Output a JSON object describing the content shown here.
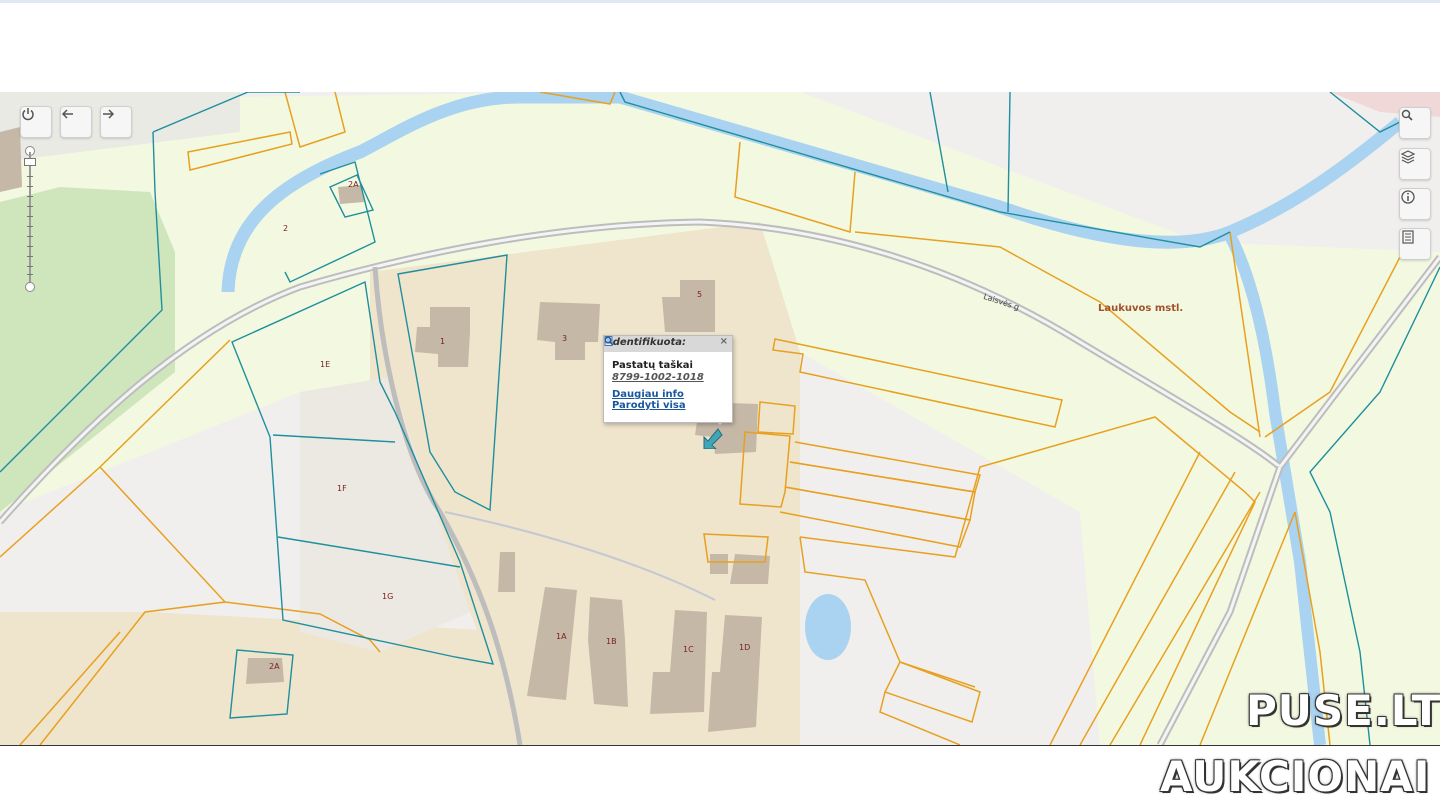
{
  "map": {
    "town_label": "Laukuvos mstl.",
    "street_label": "Laisvės g",
    "parcel_labels": [
      "2A",
      "2",
      "1E",
      "1F",
      "1G",
      "2A"
    ],
    "building_labels": [
      "5",
      "3",
      "1",
      "1A",
      "1B",
      "1C",
      "1D"
    ]
  },
  "controls": {
    "power_icon": "power-icon",
    "back_icon": "arrow-left-icon",
    "forward_icon": "arrow-right-icon",
    "search_icon": "search-icon",
    "layers_icon": "layers-icon",
    "info_icon": "info-icon",
    "legend_icon": "document-icon"
  },
  "popup": {
    "header": "Identifikuota:",
    "title": "Pastatų taškai",
    "code": "8799-1002-1018",
    "more_info": "Daugiau info",
    "show_all": "Parodyti visa"
  },
  "watermark": {
    "line1": "PUSE.LT",
    "line2": "AUKCIONAI"
  },
  "colors": {
    "water": "#a9d3f0",
    "meadow": "#f1f8dd",
    "residential": "#efe4cc",
    "building": "#c6b8a6",
    "parcel_orange": "#e8a020",
    "parcel_teal": "#1f8f9e"
  }
}
